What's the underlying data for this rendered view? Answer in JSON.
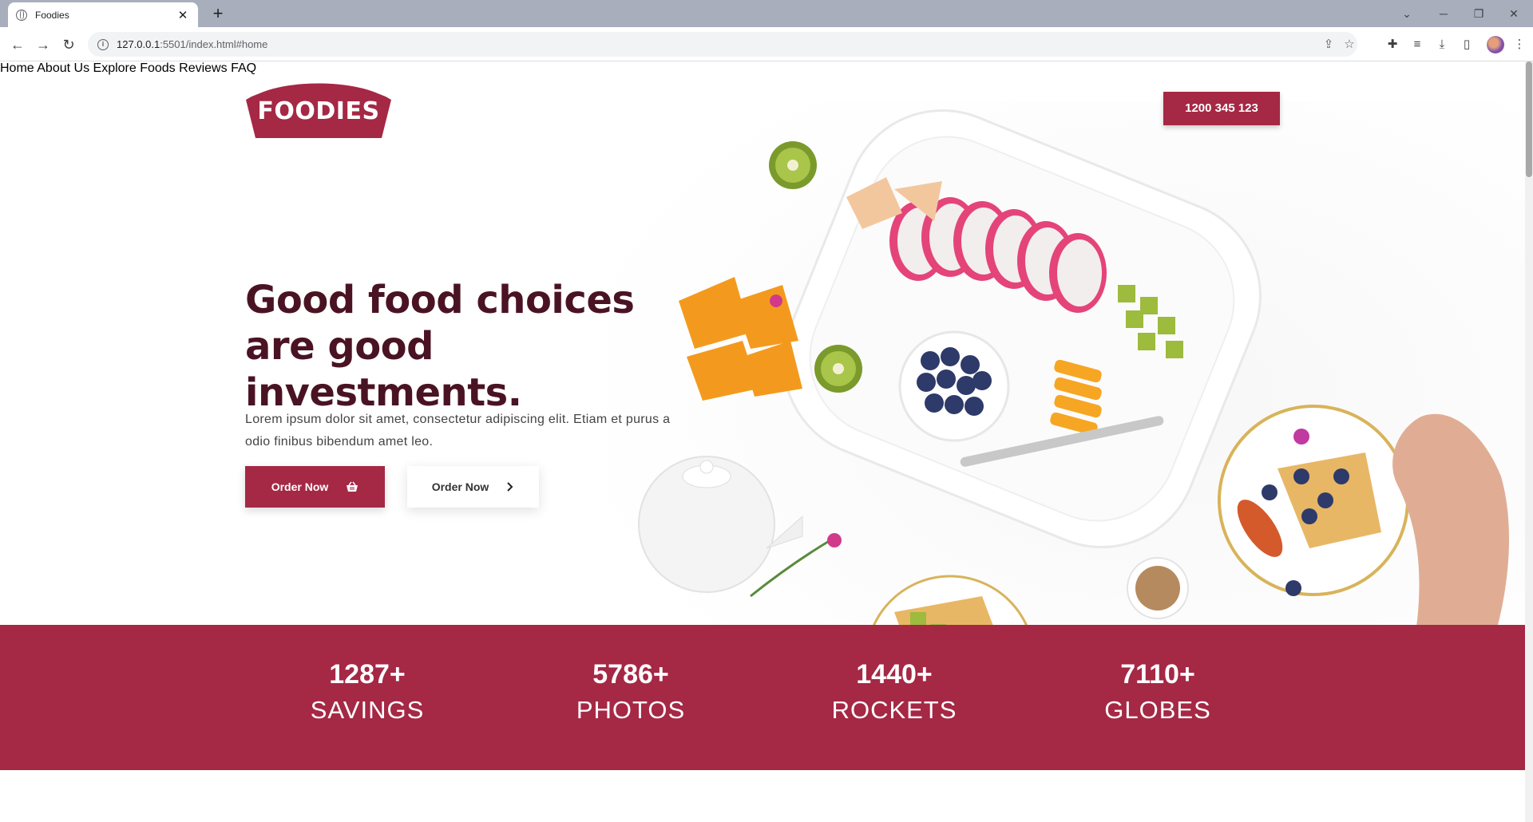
{
  "browser": {
    "tab_title": "Foodies",
    "tab_close": "✕",
    "new_tab": "+",
    "url_host": "127.0.0.1",
    "url_rest": ":5501/index.html#home"
  },
  "nav": {
    "items": [
      {
        "label": "Home"
      },
      {
        "label": "About Us"
      },
      {
        "label": "Explore Foods"
      },
      {
        "label": "Reviews"
      },
      {
        "label": "FAQ"
      }
    ],
    "phone": "1200 345 123"
  },
  "logo": {
    "text": "FOODIES"
  },
  "hero": {
    "headline": "Good food choices are good investments.",
    "lead": "Lorem ipsum dolor sit amet, consectetur adipiscing elit. Etiam et purus a odio finibus bibendum amet leo.",
    "primary_button": "Order Now",
    "secondary_button": "Order Now"
  },
  "stats": [
    {
      "number": "1287+",
      "label": "SAVINGS"
    },
    {
      "number": "5786+",
      "label": "PHOTOS"
    },
    {
      "number": "1440+",
      "label": "ROCKETS"
    },
    {
      "number": "7110+",
      "label": "GLOBES"
    }
  ],
  "colors": {
    "brand": "#a52845",
    "headline": "#4a1324"
  },
  "icons": [
    "globe-icon",
    "close-icon",
    "plus-icon",
    "back-icon",
    "forward-icon",
    "reload-icon",
    "info-icon",
    "share-icon",
    "star-icon",
    "puzzle-icon",
    "media-icon",
    "download-icon",
    "sidepanel-icon",
    "basket-icon",
    "chevron-right-icon"
  ]
}
